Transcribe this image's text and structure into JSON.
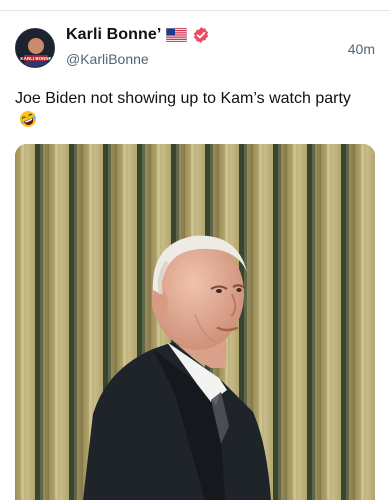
{
  "post": {
    "author_name": "Karli Bonne’",
    "handle": "@KarliBonne",
    "timestamp": "40m",
    "text": "Joe Biden not showing up to Kam’s watch party",
    "avatar_text": "KARLI BONNE",
    "emoji": "rolling-on-floor-laughing",
    "flag": "us-flag",
    "badge_color": "#ef4a62"
  },
  "media": {
    "subject": "video-frame",
    "curtain_colors": [
      "#cbbf87",
      "#3d4a34",
      "#e1d6a0"
    ]
  }
}
